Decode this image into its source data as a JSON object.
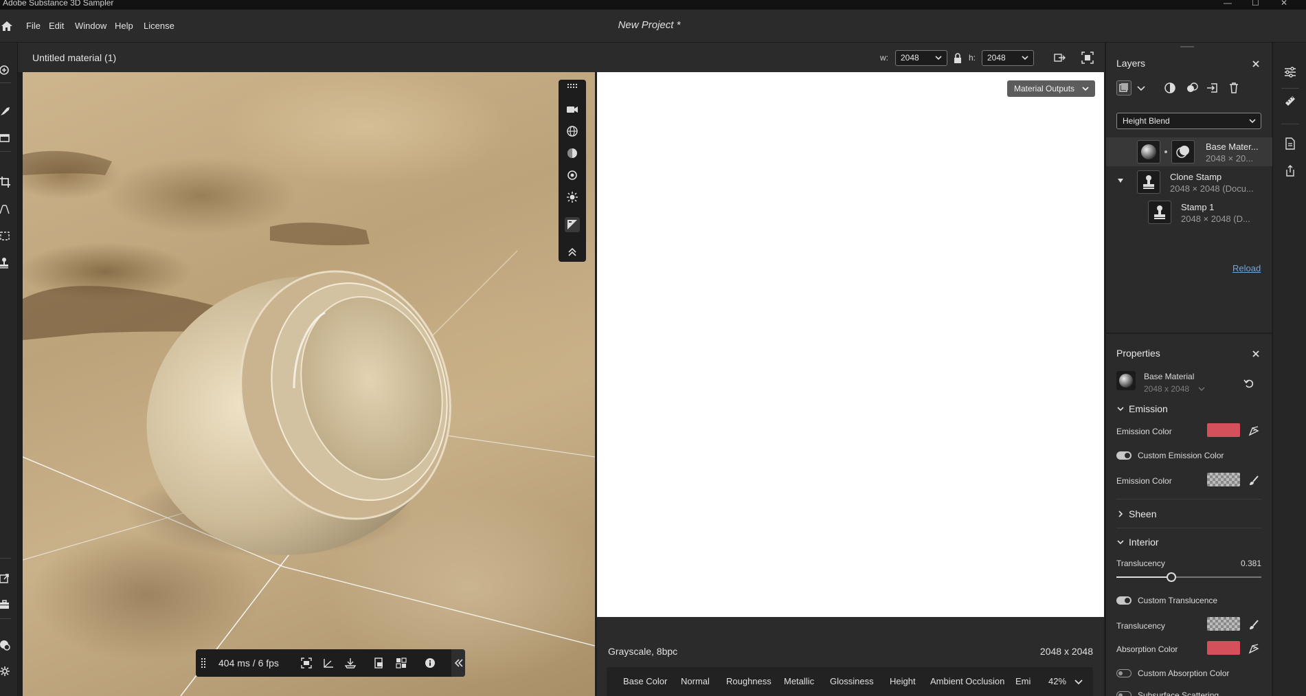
{
  "app": {
    "title": "Adobe Substance 3D Sampler",
    "project": "New Project *"
  },
  "window_controls": {
    "minimize": "—",
    "maximize": "☐",
    "close": "✕"
  },
  "menu": {
    "items": [
      "File",
      "Edit",
      "Window",
      "Help",
      "License"
    ]
  },
  "header": {
    "material_name": "Untitled material (1)",
    "width_label": "w:",
    "width_value": "2048",
    "height_label": "h:",
    "height_value": "2048"
  },
  "viewport": {
    "fps": "404 ms / 6 fps"
  },
  "view2d": {
    "output_dropdown": "Material Outputs",
    "format": "Grayscale, 8bpc",
    "resolution": "2048 x 2048",
    "channels": [
      "Base Color",
      "Normal",
      "Roughness",
      "Metallic",
      "Glossiness",
      "Height",
      "Ambient Occlusion",
      "Emi"
    ],
    "zoom": "42%"
  },
  "layers": {
    "title": "Layers",
    "blend_mode": "Height Blend",
    "items": [
      {
        "name": "Base Mater...",
        "sub": "2048 × 20..."
      },
      {
        "name": "Clone Stamp",
        "sub": "2048 × 2048 (Docu..."
      },
      {
        "name": "Stamp 1",
        "sub": "2048 × 2048 (D..."
      }
    ],
    "reload": "Reload"
  },
  "properties": {
    "title": "Properties",
    "layer_name": "Base Material",
    "layer_size": "2048 x 2048",
    "emission": {
      "title": "Emission",
      "color_label": "Emission Color",
      "custom_toggle": "Custom Emission Color",
      "custom_color_label": "Emission Color"
    },
    "sheen": {
      "title": "Sheen"
    },
    "interior": {
      "title": "Interior",
      "translucency_label": "Translucency",
      "translucency_value": "0.381",
      "translucency_fraction": 0.381,
      "custom_translucence": "Custom Translucence",
      "translucency_map_label": "Translucency",
      "absorption_label": "Absorption Color",
      "custom_absorption": "Custom Absorption Color",
      "subsurface_partial": "Subsurface Scattering"
    }
  },
  "colors": {
    "accent_red": "#d4505a",
    "link_blue": "#6fa8dc",
    "panel_bg": "#2b2b2b"
  }
}
